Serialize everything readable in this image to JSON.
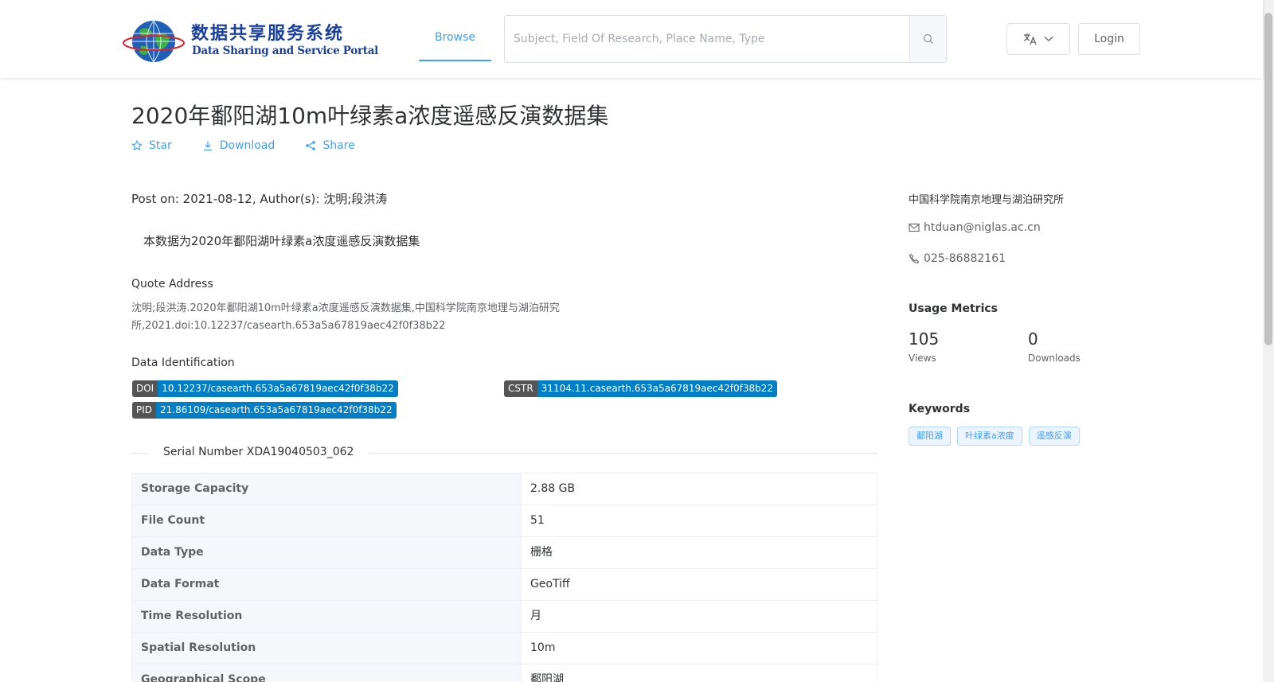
{
  "header": {
    "logo_cn": "数据共享服务系统",
    "logo_en": "Data Sharing and Service Portal",
    "nav": {
      "browse": "Browse"
    },
    "search": {
      "placeholder": "Subject, Field Of Research, Place Name, Type",
      "value": ""
    },
    "login": "Login"
  },
  "dataset": {
    "title": "2020年鄱阳湖10m叶绿素a浓度遥感反演数据集",
    "actions": {
      "star": "Star",
      "download": "Download",
      "share": "Share"
    },
    "post_line": "Post on: 2021-08-12, Author(s): 沈明;段洪涛",
    "description": "本数据为2020年鄱阳湖叶绿素a浓度遥感反演数据集",
    "quote_heading": "Quote Address",
    "quote_text": "沈明;段洪涛.2020年鄱阳湖10m叶绿素a浓度遥感反演数据集,中国科学院南京地理与湖泊研究所,2021.doi:10.12237/casearth.653a5a67819aec42f0f38b22",
    "identification_heading": "Data Identification",
    "identifiers": {
      "doi": {
        "label": "DOI",
        "value": "10.12237/casearth.653a5a67819aec42f0f38b22"
      },
      "cstr": {
        "label": "CSTR",
        "value": "31104.11.casearth.653a5a67819aec42f0f38b22"
      },
      "pid": {
        "label": "PID",
        "value": "21.86109/casearth.653a5a67819aec42f0f38b22"
      }
    },
    "serial_number": "Serial Number XDA19040503_062",
    "table": [
      {
        "key": "Storage Capacity",
        "value": "2.88 GB"
      },
      {
        "key": "File Count",
        "value": "51"
      },
      {
        "key": "Data Type",
        "value": "栅格"
      },
      {
        "key": "Data Format",
        "value": "GeoTiff"
      },
      {
        "key": "Time Resolution",
        "value": "月"
      },
      {
        "key": "Spatial Resolution",
        "value": "10m"
      },
      {
        "key": "Geographical Scope",
        "value": "鄱阳湖"
      }
    ]
  },
  "sidebar": {
    "organization": "中国科学院南京地理与湖泊研究所",
    "email": "htduan@niglas.ac.cn",
    "phone": "025-86882161",
    "metrics_heading": "Usage Metrics",
    "views": {
      "value": "105",
      "label": "Views"
    },
    "downloads": {
      "value": "0",
      "label": "Downloads"
    },
    "keywords_heading": "Keywords",
    "keywords": [
      "鄱阳湖",
      "叶绿素a浓度",
      "遥感反演"
    ]
  },
  "colors": {
    "accent": "#409eff",
    "badge_key": "#555555",
    "badge_value": "#007ec6"
  }
}
